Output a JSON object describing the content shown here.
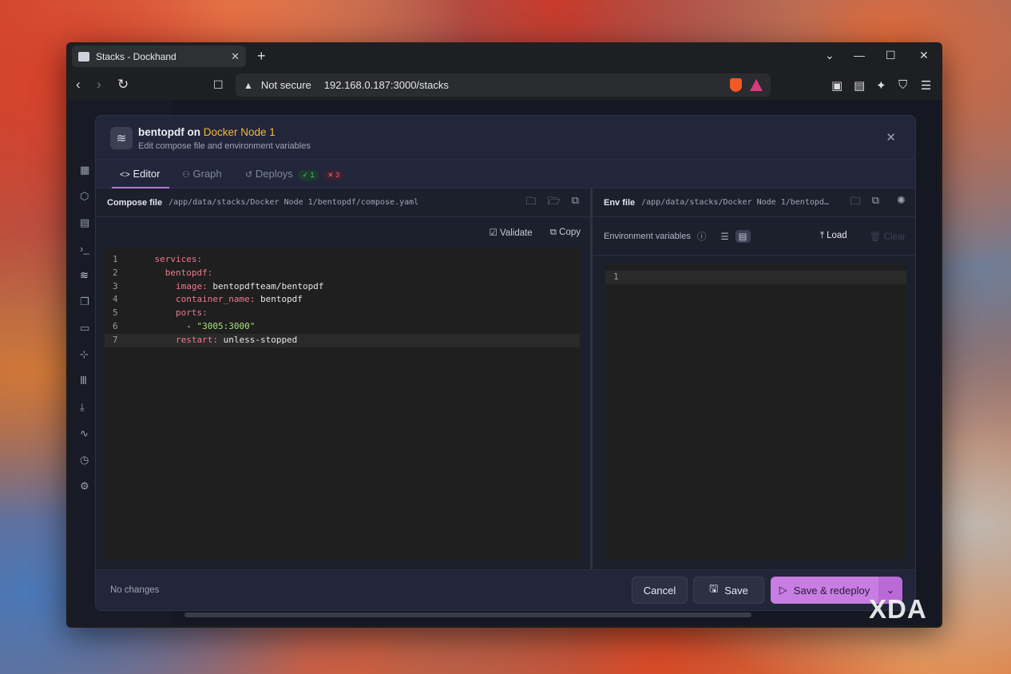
{
  "browser": {
    "tab_title": "Stacks - Dockhand",
    "new_tab_label": "+",
    "security_label": "Not secure",
    "url": "192.168.0.187:3000/stacks"
  },
  "modal": {
    "stack_name": "bentopdf",
    "on_label": "on",
    "node_name": "Docker Node 1",
    "subtitle": "Edit compose file and environment variables",
    "tabs": [
      {
        "label": "Editor",
        "active": true
      },
      {
        "label": "Graph",
        "active": false
      },
      {
        "label": "Deploys",
        "active": false,
        "success_count": "1",
        "fail_count": "3"
      }
    ],
    "compose": {
      "label": "Compose file",
      "path": "/app/data/stacks/Docker Node 1/bentopdf/compose.yaml",
      "validate_label": "Validate",
      "copy_label": "Copy",
      "lines": [
        {
          "n": "1",
          "indent": "    ",
          "key": "services",
          "value": "",
          "string": ""
        },
        {
          "n": "2",
          "indent": "      ",
          "key": "bentopdf",
          "value": "",
          "string": ""
        },
        {
          "n": "3",
          "indent": "        ",
          "key": "image",
          "value": " bentopdfteam/bentopdf",
          "string": ""
        },
        {
          "n": "4",
          "indent": "        ",
          "key": "container_name",
          "value": " bentopdf",
          "string": ""
        },
        {
          "n": "5",
          "indent": "        ",
          "key": "ports",
          "value": "",
          "string": ""
        },
        {
          "n": "6",
          "indent": "          - ",
          "key": "",
          "value": "",
          "string": "\"3005:3000\""
        },
        {
          "n": "7",
          "indent": "        ",
          "key": "restart",
          "value": " unless-stopped",
          "string": ""
        }
      ]
    },
    "env": {
      "label": "Env file",
      "path": "/app/data/stacks/Docker Node 1/bentopd…",
      "variables_label": "Environment variables",
      "load_label": "Load",
      "clear_label": "Clear",
      "line_number": "1"
    },
    "footer": {
      "status": "No changes",
      "cancel_label": "Cancel",
      "save_label": "Save",
      "redeploy_label": "Save & redeploy"
    }
  },
  "watermark": "XDA",
  "colors": {
    "accent": "#c77de2",
    "node": "#f2b935",
    "yaml_key": "#f07890",
    "yaml_string": "#a6e07a"
  }
}
